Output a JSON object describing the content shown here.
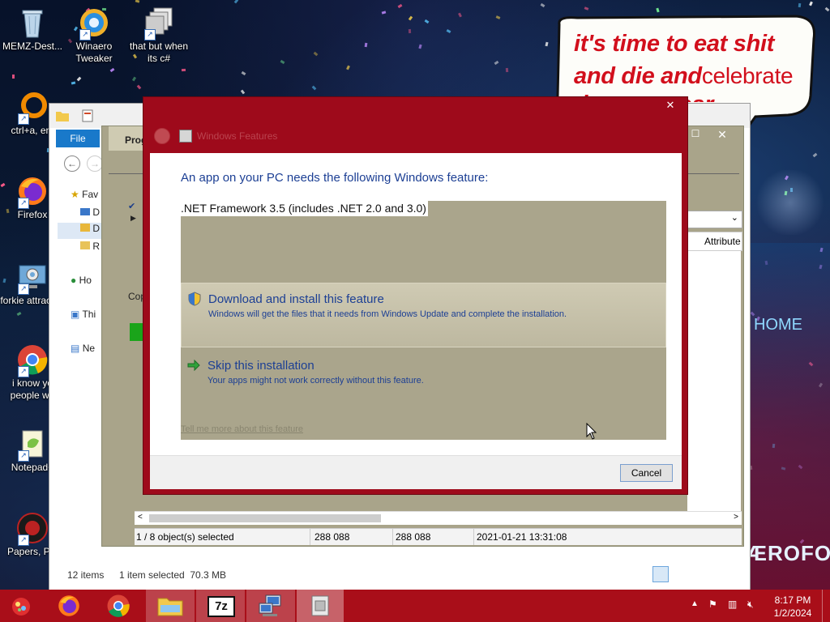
{
  "desktop": {
    "icons": [
      {
        "label": "MEMZ-Dest...",
        "icon": "recycle-bin-icon"
      },
      {
        "label": "Winaero Tweaker",
        "icon": "winaero-icon"
      },
      {
        "label": "that but when its c#",
        "icon": "stacked-windows-icon"
      },
      {
        "label": "ctrl+a, ent",
        "icon": "orange-ring-icon"
      },
      {
        "label": "Firefox",
        "icon": "firefox-icon"
      },
      {
        "label": "forkie attractan",
        "icon": "gear-monitor-icon"
      },
      {
        "label": "i know yo people we",
        "icon": "chrome-icon"
      },
      {
        "label": "Notepad+",
        "icon": "notepad-plus-icon"
      },
      {
        "label": "Papers, Ple",
        "icon": "papers-please-icon"
      }
    ],
    "bubble": {
      "line1": "it's time to eat shit",
      "line2a": "and die and",
      "line2b": "celebrate",
      "line3": "the new year"
    }
  },
  "explorer": {
    "file_tab": "File",
    "nav_items": [
      "Fav",
      "D",
      "D",
      "R",
      "Ho",
      "Thi",
      "Ne"
    ],
    "status_items": "12 items",
    "status_selected": "1 item selected  70.3 MB"
  },
  "progress_dialog": {
    "heading": "Prog",
    "copy_label": "Cop",
    "column_attributes": "Attribute",
    "status": {
      "selected": "1 / 8 object(s) selected",
      "size1": "288 088",
      "size2": "288 088",
      "date": "2021-01-21 13:31:08"
    }
  },
  "feature_dialog": {
    "title": "Windows Features",
    "heading": "An app on your PC needs the following Windows feature:",
    "feature_name": ".NET Framework 3.5 (includes .NET 2.0 and 3.0)",
    "option1_title": "Download and install this feature",
    "option1_desc": "Windows will get the files that it needs from Windows Update and complete the installation.",
    "option2_title": "Skip this installation",
    "option2_desc": "Your apps might not work correctly without this feature.",
    "link": "Tell me more about this feature",
    "cancel": "Cancel",
    "close": "✕"
  },
  "taskbar": {
    "apps": [
      "start-button",
      "firefox-icon",
      "chrome-icon",
      "file-explorer-icon",
      "7zip-icon",
      "network-computer-icon",
      "windows-features-icon"
    ],
    "time": "8:17 PM",
    "date": "1/2/2024"
  },
  "colors": {
    "taskbar": "#a90e19",
    "dialog_frame": "#9e0a1b",
    "dialog_body": "#aaa58c",
    "link_blue": "#1c3f94"
  }
}
